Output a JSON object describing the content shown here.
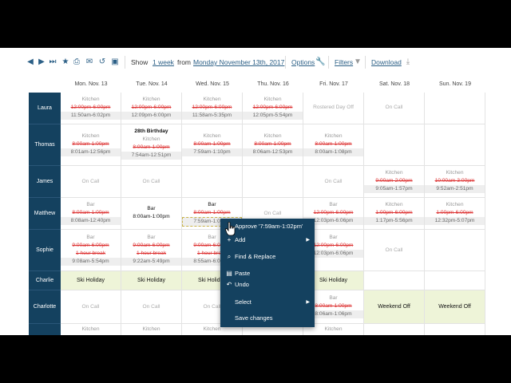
{
  "toolbar": {
    "show_label": "Show",
    "period": "1 week",
    "from_label": "from",
    "date": "Monday November 13th, 2017",
    "options": "Options",
    "filters": "Filters",
    "download": "Download"
  },
  "days": [
    "Mon. Nov. 13",
    "Tue. Nov. 14",
    "Wed. Nov. 15",
    "Thu. Nov. 16",
    "Fri. Nov. 17",
    "Sat. Nov. 18",
    "Sun. Nov. 19"
  ],
  "people": [
    "Laura",
    "Thomas",
    "James",
    "Matthew",
    "Sophie",
    "Charlie",
    "Charlotte"
  ],
  "rows": {
    "laura": [
      [
        "Kitchen",
        "12:00pm-6:00pm",
        "11:50am-6:02pm"
      ],
      [
        "Kitchen",
        "12:00pm-6:00pm",
        "12:09pm-6:00pm"
      ],
      [
        "Kitchen",
        "12:00pm-6:00pm",
        "11:58am-5:35pm"
      ],
      [
        "Kitchen",
        "12:00pm-6:00pm",
        "12:05pm-5:54pm"
      ],
      "Rostered Day Off",
      "On Call"
    ],
    "thomas": [
      [
        "Kitchen",
        "8:00am-1:00pm",
        "8:01am-12:56pm"
      ],
      [
        "28th Birthday",
        "Kitchen",
        "8:00am-1:00pm",
        "7:54am-12:51pm"
      ],
      [
        "Kitchen",
        "8:00am-1:00pm",
        "7:59am-1:10pm"
      ],
      [
        "Kitchen",
        "8:00am-1:00pm",
        "8:06am-12:53pm"
      ],
      [
        "Kitchen",
        "8:00am-1:00pm",
        "8:00am-1:08pm"
      ]
    ],
    "james": [
      "On Call",
      "On Call",
      "On Call",
      [
        "Kitchen",
        "9:00am-2:00pm",
        "9:05am-1:57pm"
      ],
      [
        "Kitchen",
        "10:00am-3:00pm",
        "9:52am-2:51pm"
      ]
    ],
    "matthew": [
      [
        "Bar",
        "8:00am-1:00pm",
        "8:08am-12:40pm"
      ],
      [
        "Bar",
        "8:00am-1:00pm"
      ],
      [
        "Bar",
        "8:00am-1:00pm",
        "7:59am-1:02pm"
      ],
      "On Call",
      [
        "Bar",
        "12:00pm-6:00pm",
        "12:03pm-6:06pm"
      ],
      [
        "Kitchen",
        "1:00pm-6:00pm",
        "1:17pm-5:56pm"
      ],
      [
        "Kitchen",
        "1:00pm-6:00pm",
        "12:32pm-5:07pm"
      ]
    ],
    "sophie": [
      [
        "Bar",
        "9:00am-6:00pm",
        "1 hour break",
        "9:08am-5:54pm"
      ],
      [
        "Bar",
        "9:00am-6:00pm",
        "1 hour break",
        "9:22am-5:49pm"
      ],
      [
        "Bar",
        "9:00am-6:00pm",
        "1 hour break",
        "8:55am-6:00pm"
      ],
      [
        "Bar",
        "12:00pm-6:00pm",
        "12:03pm-6:06pm"
      ],
      "On Call"
    ],
    "charlie": [
      "Ski Holiday",
      "Ski Holiday",
      "Ski Holiday",
      "Ski Holiday"
    ],
    "charlotte": [
      "On Call",
      "On Call",
      "On Call",
      [
        "Bar",
        "8:00am-1:00pm",
        "8:06am-1:06pm"
      ],
      "Weekend Off",
      "Weekend Off"
    ],
    "partial": [
      "Kitchen",
      "Kitchen",
      "Kitchen",
      "Kitchen"
    ]
  },
  "menu": {
    "approve": "Approve '7:59am-1:02pm'",
    "add": "Add",
    "find_replace": "Find & Replace",
    "paste": "Paste",
    "undo": "Undo",
    "select": "Select",
    "save": "Save changes"
  },
  "colors": {
    "accent": "#14415f",
    "strike": "#dd3333",
    "holiday": "#eef4d8"
  }
}
